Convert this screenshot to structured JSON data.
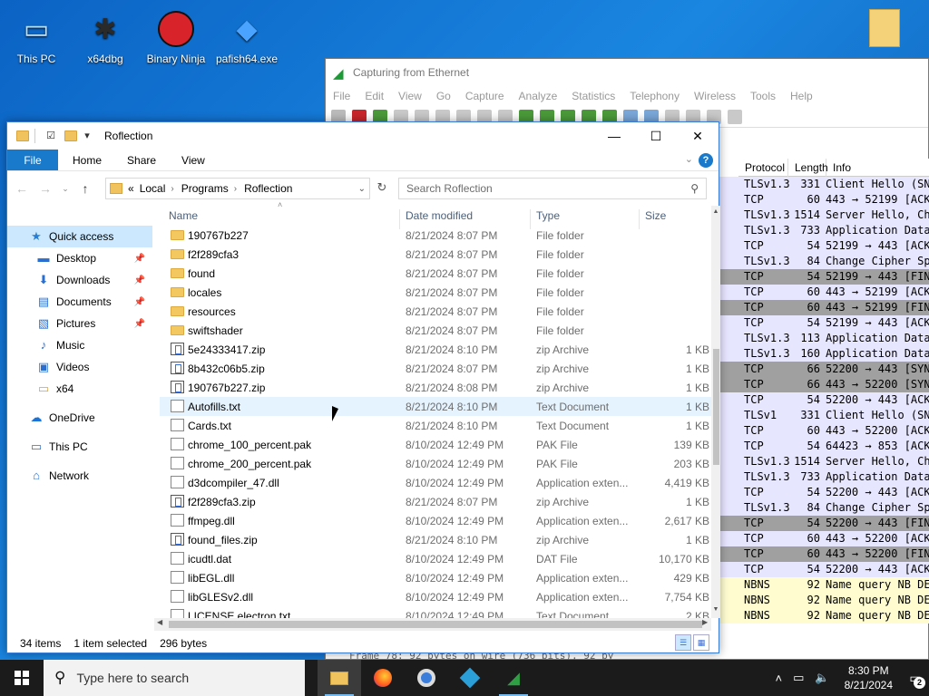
{
  "desktop": {
    "icons": [
      {
        "label": "This PC"
      },
      {
        "label": "x64dbg"
      },
      {
        "label": "Binary Ninja"
      },
      {
        "label": "pafish64.exe"
      }
    ]
  },
  "wireshark": {
    "title": "Capturing from Ethernet",
    "menu": [
      "File",
      "Edit",
      "View",
      "Go",
      "Capture",
      "Analyze",
      "Statistics",
      "Telephony",
      "Wireless",
      "Tools",
      "Help"
    ],
    "columns": {
      "protocol": "Protocol",
      "length": "Length",
      "info": "Info"
    },
    "rows": [
      {
        "protocol": "TLSv1.3",
        "length": "331",
        "info": "Client Hello (SN",
        "style": "tls"
      },
      {
        "protocol": "TCP",
        "length": "60",
        "info": "443 → 52199 [ACK",
        "style": "tls"
      },
      {
        "protocol": "TLSv1.3",
        "length": "1514",
        "info": "Server Hello, Ch",
        "style": "tls"
      },
      {
        "protocol": "TLSv1.3",
        "length": "733",
        "info": "Application Data",
        "style": "tls"
      },
      {
        "protocol": "TCP",
        "length": "54",
        "info": "52199 → 443 [ACK",
        "style": "tls"
      },
      {
        "protocol": "TLSv1.3",
        "length": "84",
        "info": "Change Cipher Spe",
        "style": "tls"
      },
      {
        "protocol": "TCP",
        "length": "54",
        "info": "52199 → 443 [FIN",
        "style": "gray"
      },
      {
        "protocol": "TCP",
        "length": "60",
        "info": "443 → 52199 [ACK",
        "style": "tls"
      },
      {
        "protocol": "TCP",
        "length": "60",
        "info": "443 → 52199 [FIN",
        "style": "gray"
      },
      {
        "protocol": "TCP",
        "length": "54",
        "info": "52199 → 443 [ACK",
        "style": "tls"
      },
      {
        "protocol": "TLSv1.3",
        "length": "113",
        "info": "Application Data",
        "style": "tls"
      },
      {
        "protocol": "TLSv1.3",
        "length": "160",
        "info": "Application Data",
        "style": "tls"
      },
      {
        "protocol": "TCP",
        "length": "66",
        "info": "52200 → 443 [SYN",
        "style": "gray"
      },
      {
        "protocol": "TCP",
        "length": "66",
        "info": "443 → 52200 [SYN",
        "style": "gray"
      },
      {
        "protocol": "TCP",
        "length": "54",
        "info": "52200 → 443 [ACK",
        "style": "tls"
      },
      {
        "protocol": "TLSv1",
        "length": "331",
        "info": "Client Hello (SN",
        "style": "tls"
      },
      {
        "protocol": "TCP",
        "length": "60",
        "info": "443 → 52200 [ACK",
        "style": "tls"
      },
      {
        "protocol": "TCP",
        "length": "54",
        "info": "64423 → 853 [ACK",
        "style": "tls"
      },
      {
        "protocol": "TLSv1.3",
        "length": "1514",
        "info": "Server Hello, Ch",
        "style": "tls"
      },
      {
        "protocol": "TLSv1.3",
        "length": "733",
        "info": "Application Data",
        "style": "tls"
      },
      {
        "protocol": "TCP",
        "length": "54",
        "info": "52200 → 443 [ACK",
        "style": "tls"
      },
      {
        "protocol": "TLSv1.3",
        "length": "84",
        "info": "Change Cipher Spe",
        "style": "tls"
      },
      {
        "protocol": "TCP",
        "length": "54",
        "info": "52200 → 443 [FIN",
        "style": "gray"
      },
      {
        "protocol": "TCP",
        "length": "60",
        "info": "443 → 52200 [ACK",
        "style": "tls"
      },
      {
        "protocol": "TCP",
        "length": "60",
        "info": "443 → 52200 [FIN",
        "style": "gray"
      },
      {
        "protocol": "TCP",
        "length": "54",
        "info": "52200 → 443 [ACK",
        "style": "tls"
      },
      {
        "protocol": "NBNS",
        "length": "92",
        "info": "Name query NB DE",
        "style": "yel"
      },
      {
        "protocol": "NBNS",
        "length": "92",
        "info": "Name query NB DE",
        "style": "yel"
      },
      {
        "protocol": "NBNS",
        "length": "92",
        "info": "Name query NB DE",
        "style": "yel"
      }
    ],
    "detail": "Frame 78: 92 bytes on wire (736 bits), 92 by"
  },
  "explorer": {
    "title": "Roflection",
    "ribbon": {
      "file": "File",
      "tabs": [
        "Home",
        "Share",
        "View"
      ]
    },
    "address": {
      "prefix": "«",
      "crumbs": [
        "Local",
        "Programs",
        "Roflection"
      ]
    },
    "search_placeholder": "Search Roflection",
    "sidebar": [
      {
        "label": "Quick access",
        "icon": "★",
        "pinned": false,
        "selected": true,
        "indent": 24
      },
      {
        "label": "Desktop",
        "icon": "▬",
        "pinned": true,
        "indent": 32
      },
      {
        "label": "Downloads",
        "icon": "⬇",
        "pinned": true,
        "indent": 32
      },
      {
        "label": "Documents",
        "icon": "▤",
        "pinned": true,
        "indent": 32
      },
      {
        "label": "Pictures",
        "icon": "▧",
        "pinned": true,
        "indent": 32
      },
      {
        "label": "Music",
        "icon": "♪",
        "pinned": false,
        "indent": 32
      },
      {
        "label": "Videos",
        "icon": "▣",
        "pinned": false,
        "indent": 32
      },
      {
        "label": "x64",
        "icon": "▭",
        "pinned": false,
        "indent": 32
      },
      {
        "label": "OneDrive",
        "icon": "☁",
        "pinned": false,
        "indent": 24,
        "gap": true
      },
      {
        "label": "This PC",
        "icon": "▭",
        "pinned": false,
        "indent": 24,
        "gap": true
      },
      {
        "label": "Network",
        "icon": "⌂",
        "pinned": false,
        "indent": 24,
        "gap": true
      }
    ],
    "columns": {
      "name": "Name",
      "date": "Date modified",
      "type": "Type",
      "size": "Size"
    },
    "files": [
      {
        "name": "190767b227",
        "date": "8/21/2024 8:07 PM",
        "type": "File folder",
        "size": "",
        "kind": "folder"
      },
      {
        "name": "f2f289cfa3",
        "date": "8/21/2024 8:07 PM",
        "type": "File folder",
        "size": "",
        "kind": "folder"
      },
      {
        "name": "found",
        "date": "8/21/2024 8:07 PM",
        "type": "File folder",
        "size": "",
        "kind": "folder"
      },
      {
        "name": "locales",
        "date": "8/21/2024 8:07 PM",
        "type": "File folder",
        "size": "",
        "kind": "folder"
      },
      {
        "name": "resources",
        "date": "8/21/2024 8:07 PM",
        "type": "File folder",
        "size": "",
        "kind": "folder"
      },
      {
        "name": "swiftshader",
        "date": "8/21/2024 8:07 PM",
        "type": "File folder",
        "size": "",
        "kind": "folder"
      },
      {
        "name": "5e24333417.zip",
        "date": "8/21/2024 8:10 PM",
        "type": "zip Archive",
        "size": "1 KB",
        "kind": "zip"
      },
      {
        "name": "8b432c06b5.zip",
        "date": "8/21/2024 8:07 PM",
        "type": "zip Archive",
        "size": "1 KB",
        "kind": "zip"
      },
      {
        "name": "190767b227.zip",
        "date": "8/21/2024 8:08 PM",
        "type": "zip Archive",
        "size": "1 KB",
        "kind": "zip"
      },
      {
        "name": "Autofills.txt",
        "date": "8/21/2024 8:10 PM",
        "type": "Text Document",
        "size": "1 KB",
        "kind": "doc",
        "hover": true
      },
      {
        "name": "Cards.txt",
        "date": "8/21/2024 8:10 PM",
        "type": "Text Document",
        "size": "1 KB",
        "kind": "doc"
      },
      {
        "name": "chrome_100_percent.pak",
        "date": "8/10/2024 12:49 PM",
        "type": "PAK File",
        "size": "139 KB",
        "kind": "doc"
      },
      {
        "name": "chrome_200_percent.pak",
        "date": "8/10/2024 12:49 PM",
        "type": "PAK File",
        "size": "203 KB",
        "kind": "doc"
      },
      {
        "name": "d3dcompiler_47.dll",
        "date": "8/10/2024 12:49 PM",
        "type": "Application exten...",
        "size": "4,419 KB",
        "kind": "doc"
      },
      {
        "name": "f2f289cfa3.zip",
        "date": "8/21/2024 8:07 PM",
        "type": "zip Archive",
        "size": "1 KB",
        "kind": "zip"
      },
      {
        "name": "ffmpeg.dll",
        "date": "8/10/2024 12:49 PM",
        "type": "Application exten...",
        "size": "2,617 KB",
        "kind": "doc"
      },
      {
        "name": "found_files.zip",
        "date": "8/21/2024 8:10 PM",
        "type": "zip Archive",
        "size": "1 KB",
        "kind": "zip"
      },
      {
        "name": "icudtl.dat",
        "date": "8/10/2024 12:49 PM",
        "type": "DAT File",
        "size": "10,170 KB",
        "kind": "doc"
      },
      {
        "name": "libEGL.dll",
        "date": "8/10/2024 12:49 PM",
        "type": "Application exten...",
        "size": "429 KB",
        "kind": "doc"
      },
      {
        "name": "libGLESv2.dll",
        "date": "8/10/2024 12:49 PM",
        "type": "Application exten...",
        "size": "7,754 KB",
        "kind": "doc"
      },
      {
        "name": "LICENSE.electron.txt",
        "date": "8/10/2024 12:49 PM",
        "type": "Text Document",
        "size": "2 KB",
        "kind": "doc"
      }
    ],
    "status": {
      "items": "34 items",
      "selected": "1 item selected",
      "size": "296 bytes"
    }
  },
  "taskbar": {
    "search_placeholder": "Type here to search",
    "apps": [
      "file-explorer",
      "firefox",
      "chrome",
      "box-app",
      "wireshark"
    ],
    "time": "8:30 PM",
    "date": "8/21/2024",
    "notifications": "2"
  }
}
